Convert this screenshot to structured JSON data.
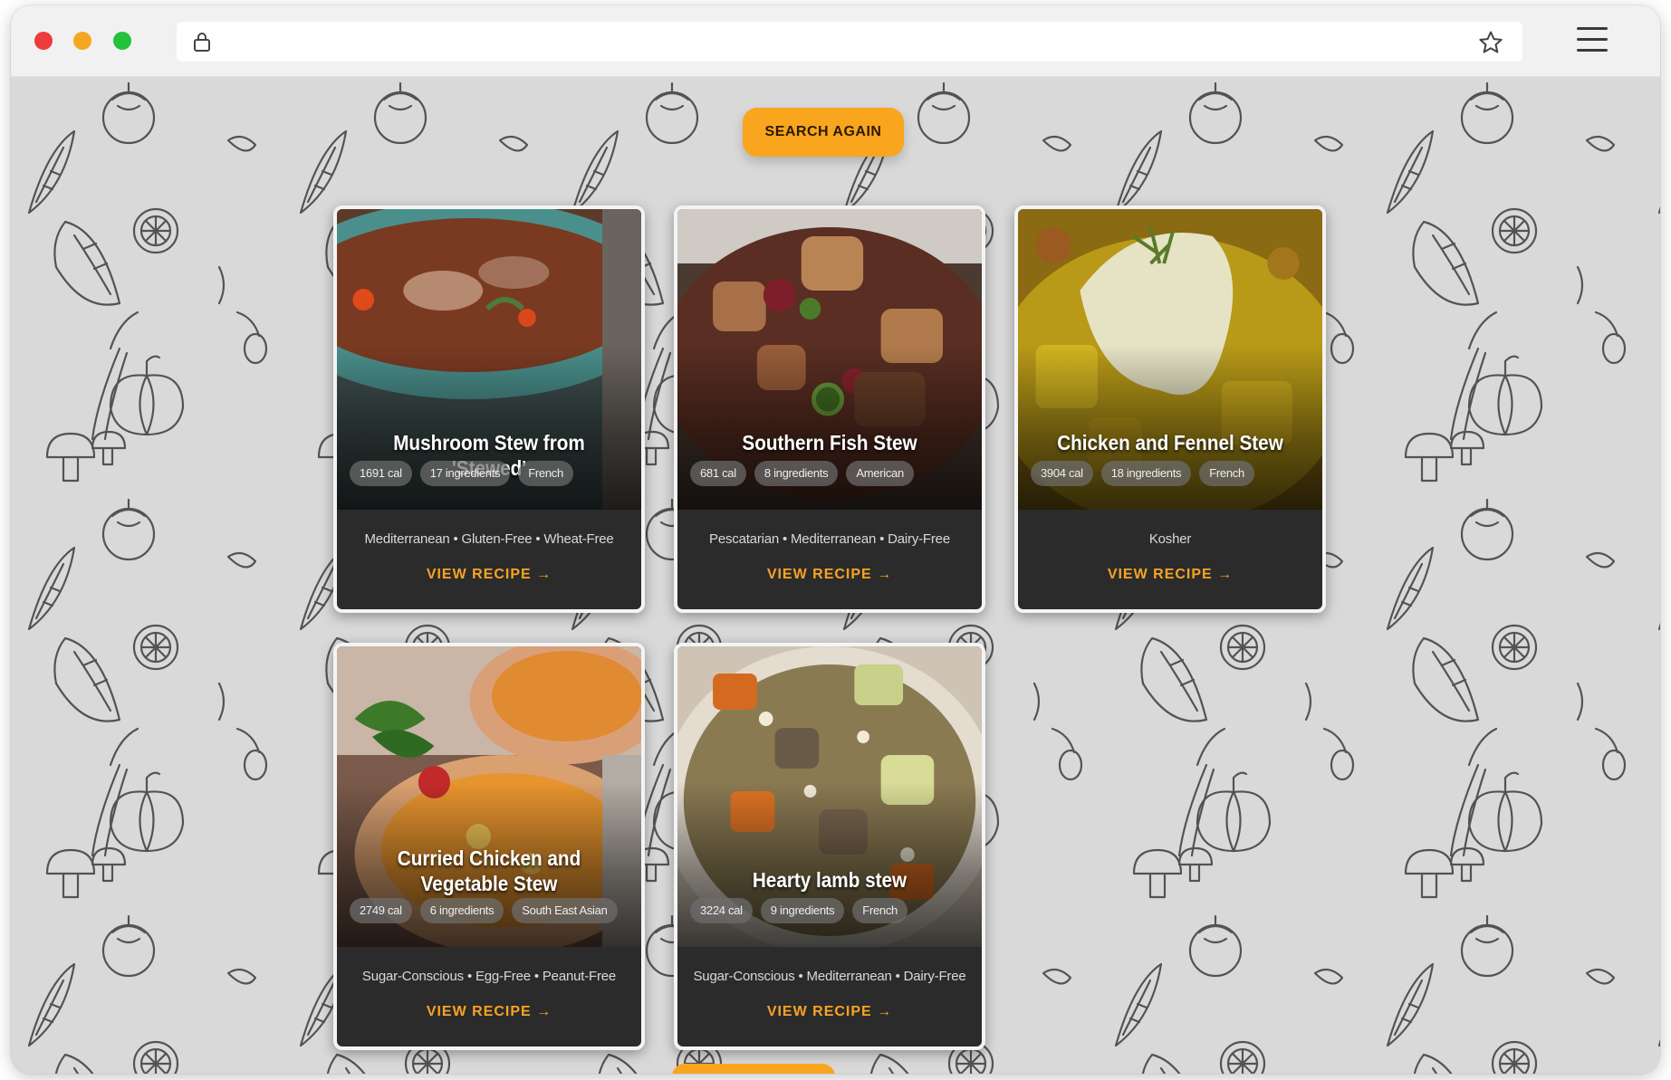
{
  "browser": {
    "lock_icon": "lock-icon",
    "bookmark_icon": "star-icon",
    "menu_icon": "hamburger-menu-icon",
    "url": ""
  },
  "page": {
    "search_again_label": "SEARCH AGAIN",
    "accent_color": "#f9a51e",
    "background_pattern": "hand-drawn vegetable doodles"
  },
  "recipes": [
    {
      "title": "Mushroom Stew from 'Stewed'",
      "calories": "1691 cal",
      "ingredients": "17 ingredients",
      "cuisine": "French",
      "labels": "Mediterranean • Gluten-Free • Wheat-Free",
      "cta": "VIEW RECIPE →"
    },
    {
      "title": "Southern Fish Stew",
      "calories": "681 cal",
      "ingredients": "8 ingredients",
      "cuisine": "American",
      "labels": "Pescatarian • Mediterranean • Dairy-Free",
      "cta": "VIEW RECIPE →"
    },
    {
      "title": "Chicken and Fennel Stew",
      "calories": "3904 cal",
      "ingredients": "18 ingredients",
      "cuisine": "French",
      "labels": "Kosher",
      "cta": "VIEW RECIPE →"
    },
    {
      "title": "Curried Chicken and Vegetable Stew",
      "calories": "2749 cal",
      "ingredients": "6 ingredients",
      "cuisine": "South East Asian",
      "labels": "Sugar-Conscious • Egg-Free • Peanut-Free",
      "cta": "VIEW RECIPE →"
    },
    {
      "title": "Hearty lamb stew",
      "calories": "3224 cal",
      "ingredients": "9 ingredients",
      "cuisine": "French",
      "labels": "Sugar-Conscious • Mediterranean • Dairy-Free",
      "cta": "VIEW RECIPE →"
    }
  ]
}
